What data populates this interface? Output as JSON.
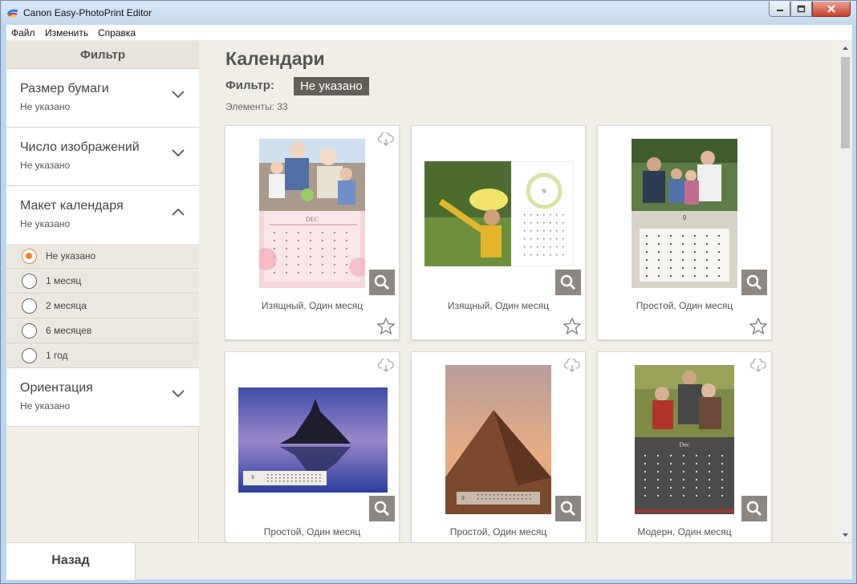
{
  "window": {
    "title": "Canon Easy-PhotoPrint Editor"
  },
  "menu": [
    "Файл",
    "Изменить",
    "Справка"
  ],
  "sidebar": {
    "header": "Фильтр",
    "sections": [
      {
        "title": "Размер бумаги",
        "value": "Не указано"
      },
      {
        "title": "Число изображений",
        "value": "Не указано"
      },
      {
        "title": "Макет календаря",
        "value": "Не указано",
        "expanded": true
      },
      {
        "title": "Ориентация",
        "value": "Не указано"
      }
    ],
    "layout_options": [
      {
        "label": "Не указано",
        "selected": true
      },
      {
        "label": "1 месяц",
        "selected": false
      },
      {
        "label": "2 месяца",
        "selected": false
      },
      {
        "label": "6 месяцев",
        "selected": false
      },
      {
        "label": "1 год",
        "selected": false
      }
    ]
  },
  "main": {
    "heading": "Календари",
    "filter_label": "Фильтр:",
    "filter_value": "Не указано",
    "count": "Элементы: 33"
  },
  "cards": [
    {
      "caption": "Изящный, Один месяц",
      "month": "DEC"
    },
    {
      "caption": "Изящный, Один месяц",
      "month": "9"
    },
    {
      "caption": "Простой, Один месяц",
      "month": "9"
    },
    {
      "caption": "Простой, Один месяц",
      "month": "9"
    },
    {
      "caption": "Простой, Один месяц",
      "month": "9"
    },
    {
      "caption": "Модерн, Один месяц",
      "month": "Dec"
    }
  ],
  "footer": {
    "back": "Назад"
  },
  "colors": {
    "accent": "#e8852f",
    "badge": "#645e58",
    "panel": "#f1eee8"
  }
}
